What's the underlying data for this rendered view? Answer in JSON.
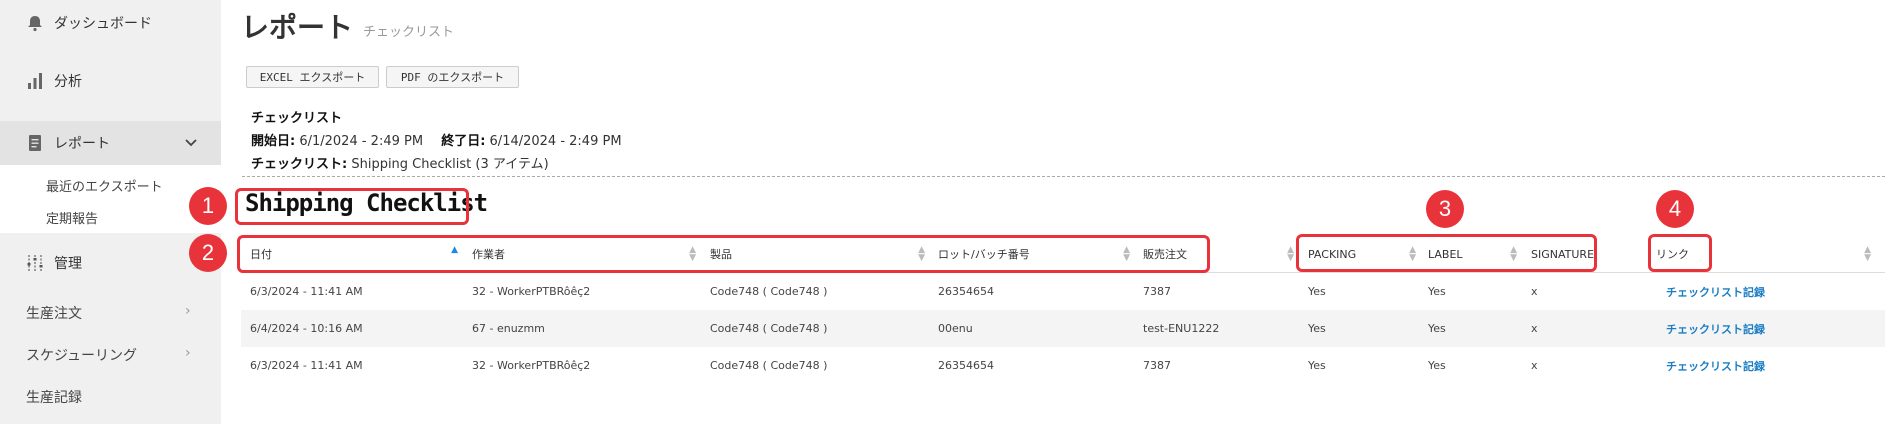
{
  "sidebar": {
    "dashboard": "ダッシュボード",
    "analysis": "分析",
    "reports": "レポート",
    "recent_exports": "最近のエクスポート",
    "scheduled_reports": "定期報告",
    "management": "管理",
    "production_orders": "生産注文",
    "scheduling": "スケジューリング",
    "production_records": "生産記録"
  },
  "header": {
    "title": "レポート",
    "subtitle": "チェックリスト"
  },
  "toolbar": {
    "excel_export": "EXCEL エクスポート",
    "pdf_export": "PDF のエクスポート"
  },
  "info": {
    "heading": "チェックリスト",
    "start_label": "開始日:",
    "start_value": " 6/1/2024 - 2:49 PM",
    "end_label": "終了日:",
    "end_value": " 6/14/2024 - 2:49 PM",
    "checklist_label": "チェックリスト:",
    "checklist_value": " Shipping Checklist (3 アイテム)"
  },
  "section_title": "Shipping Checklist",
  "table": {
    "headers": [
      "日付",
      "作業者",
      "製品",
      "ロット/バッチ番号",
      "販売注文",
      "PACKING",
      "LABEL",
      "SIGNATURE",
      "リンク"
    ],
    "rows": [
      [
        "6/3/2024 - 11:41 AM",
        "32 - WorkerPTBRôêç2",
        "Code748 ( Code748 )",
        "26354654",
        "7387",
        "Yes",
        "Yes",
        "x",
        "チェックリスト記録"
      ],
      [
        "6/4/2024 - 10:16 AM",
        "67 - enuzmm",
        "Code748 ( Code748 )",
        "00enu",
        "test-ENU1222",
        "Yes",
        "Yes",
        "x",
        "チェックリスト記録"
      ],
      [
        "6/3/2024 - 11:41 AM",
        "32 - WorkerPTBRôêç2",
        "Code748 ( Code748 )",
        "26354654",
        "7387",
        "Yes",
        "Yes",
        "x",
        "チェックリスト記録"
      ]
    ]
  },
  "annotations": [
    "1",
    "2",
    "3",
    "4"
  ],
  "colors": {
    "annotation": "#e8333b",
    "link": "#1a7dc4",
    "sort_active": "#1e88e5"
  }
}
